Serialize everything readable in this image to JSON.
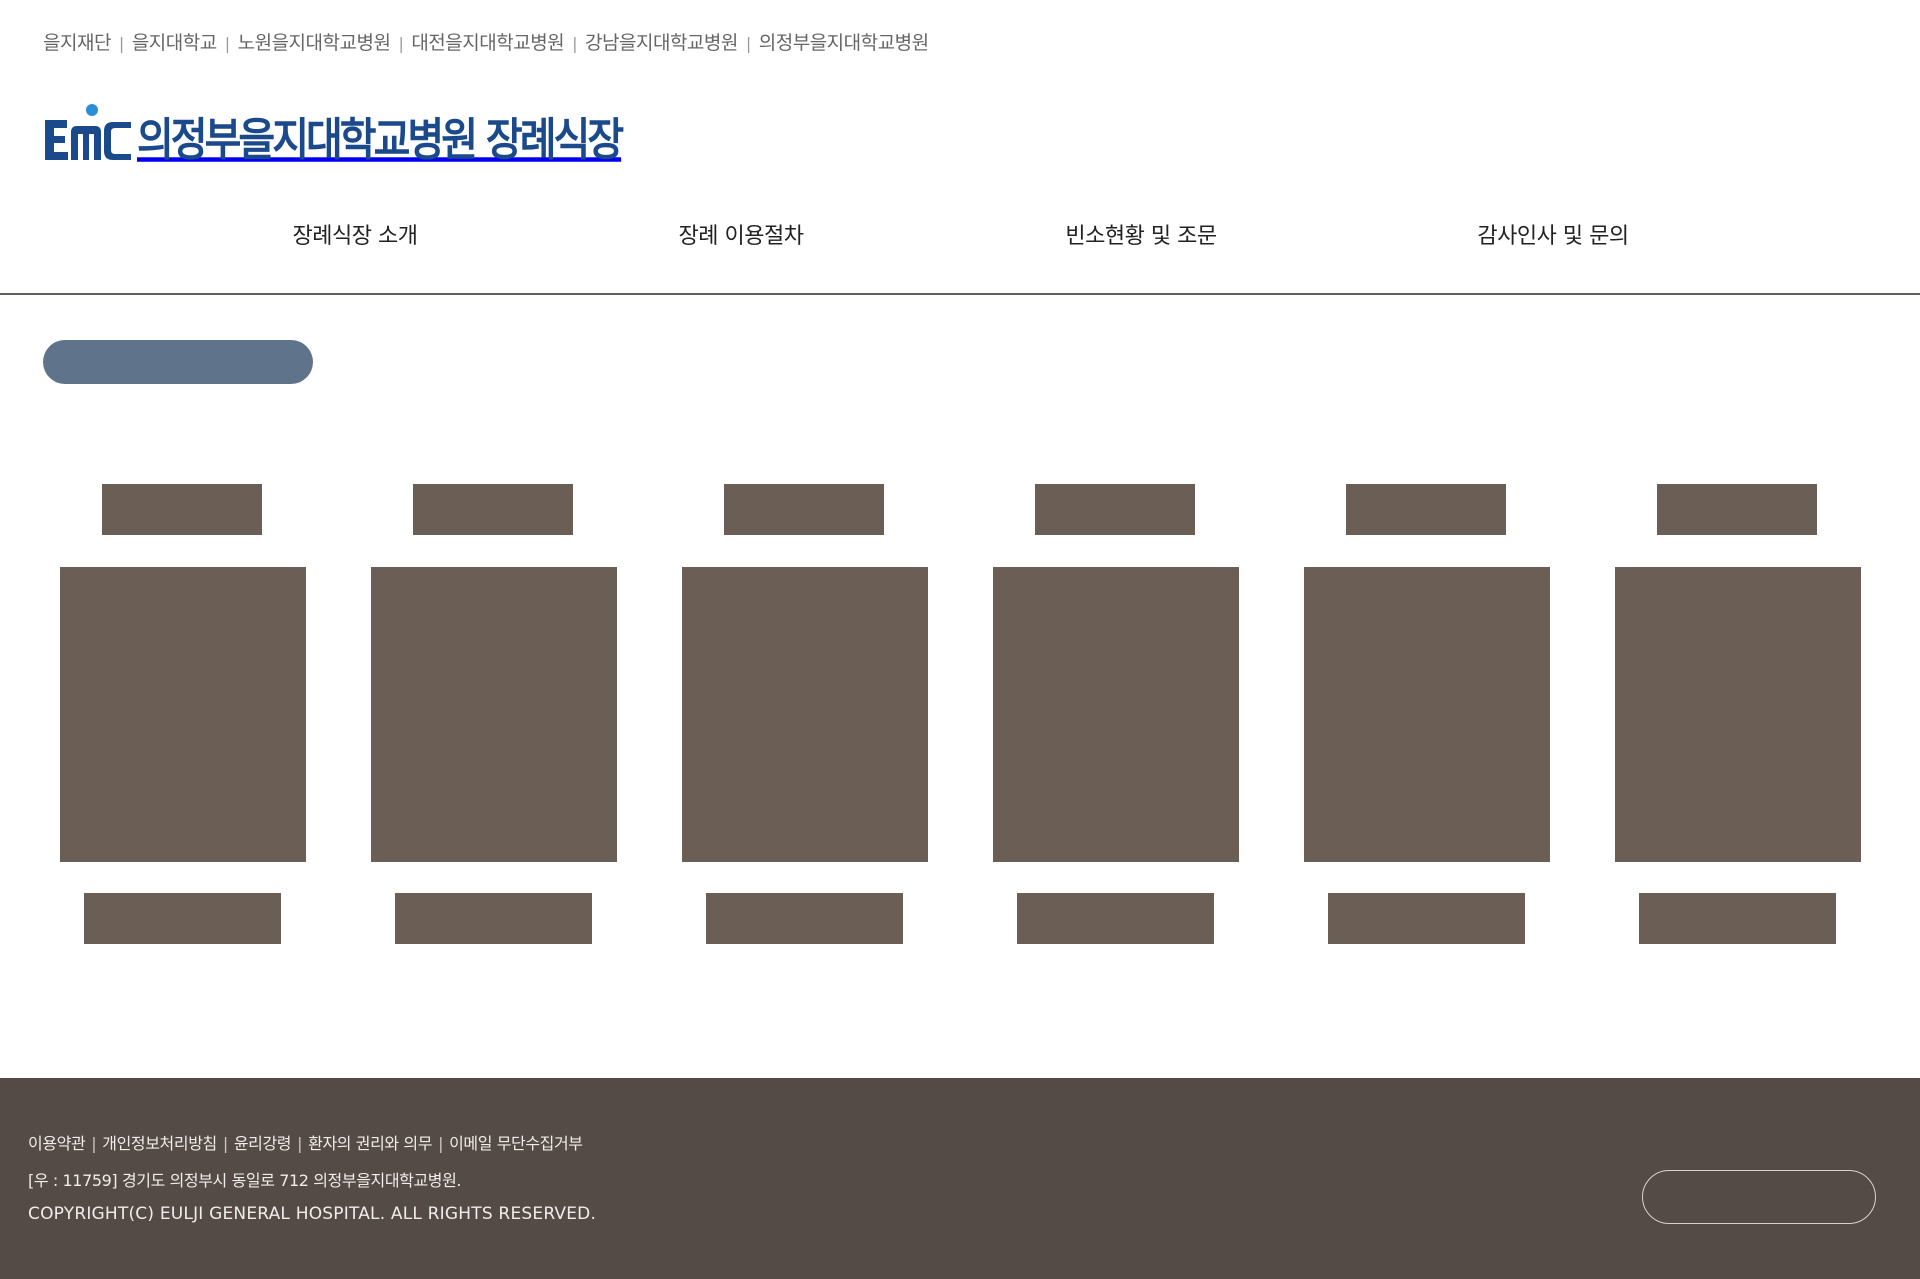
{
  "family_sites": [
    "을지재단",
    "을지대학교",
    "노원을지대학교병원",
    "대전을지대학교병원",
    "강남을지대학교병원",
    "의정부을지대학교병원"
  ],
  "separator": "|",
  "logo": {
    "mark": "EMC",
    "text": "의정부을지대학교병원 장례식장",
    "color": "#1b4a8c"
  },
  "nav": [
    "장례식장 소개",
    "장례 이용절차",
    "빈소현황 및 조문",
    "감사인사 및 문의"
  ],
  "colors": {
    "placeholder": "#6b5e55",
    "title_pill": "#5f748b",
    "footer_bg": "#554b46"
  },
  "cards_count": 6,
  "footer": {
    "links": [
      "이용약관",
      "개인정보처리방침",
      "윤리강령",
      "환자의 권리와 의무",
      "이메일 무단수집거부"
    ],
    "address": "[우 : 11759] 경기도 의정부시 동일로 712 의정부을지대학교병원.",
    "copyright": "COPYRIGHT(C) EULJI GENERAL HOSPITAL. ALL RIGHTS RESERVED."
  }
}
